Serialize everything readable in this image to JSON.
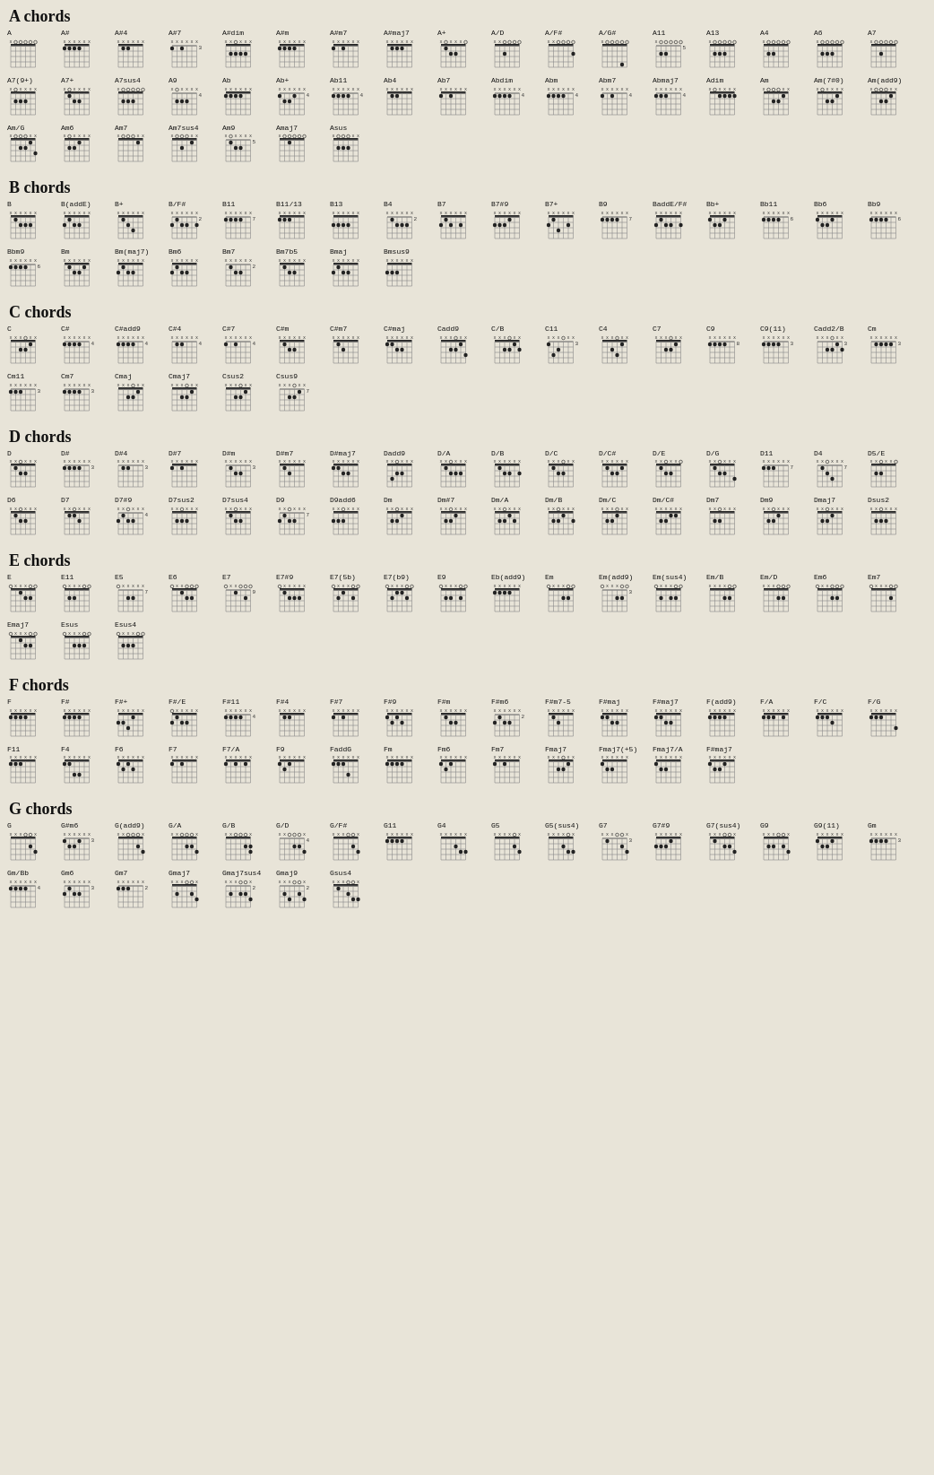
{
  "sections": [
    {
      "id": "A",
      "title": "A chords"
    },
    {
      "id": "B",
      "title": "B chords"
    },
    {
      "id": "C",
      "title": "C chords"
    },
    {
      "id": "D",
      "title": "D chords"
    },
    {
      "id": "E",
      "title": "E chords"
    },
    {
      "id": "F",
      "title": "F chords"
    },
    {
      "id": "G",
      "title": "G chords"
    }
  ]
}
